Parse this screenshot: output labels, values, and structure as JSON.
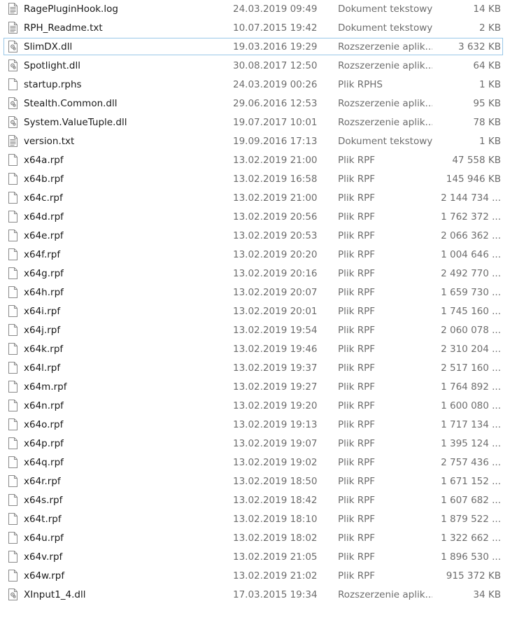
{
  "files": [
    {
      "name": "RagePluginHook.log",
      "date": "24.03.2019 09:49",
      "type": "Dokument tekstowy",
      "size": "14 KB",
      "icon": "text-file-icon"
    },
    {
      "name": "RPH_Readme.txt",
      "date": "10.07.2015 19:42",
      "type": "Dokument tekstowy",
      "size": "2 KB",
      "icon": "text-file-icon"
    },
    {
      "name": "SlimDX.dll",
      "date": "19.03.2016 19:29",
      "type": "Rozszerzenie aplik...",
      "size": "3 632 KB",
      "icon": "dll-file-icon",
      "selected": true
    },
    {
      "name": "Spotlight.dll",
      "date": "30.08.2017 12:50",
      "type": "Rozszerzenie aplik...",
      "size": "64 KB",
      "icon": "dll-file-icon"
    },
    {
      "name": "startup.rphs",
      "date": "24.03.2019 00:26",
      "type": "Plik RPHS",
      "size": "1 KB",
      "icon": "blank-file-icon"
    },
    {
      "name": "Stealth.Common.dll",
      "date": "29.06.2016 12:53",
      "type": "Rozszerzenie aplik...",
      "size": "95 KB",
      "icon": "dll-file-icon"
    },
    {
      "name": "System.ValueTuple.dll",
      "date": "19.07.2017 10:01",
      "type": "Rozszerzenie aplik...",
      "size": "78 KB",
      "icon": "dll-file-icon"
    },
    {
      "name": "version.txt",
      "date": "19.09.2016 17:13",
      "type": "Dokument tekstowy",
      "size": "1 KB",
      "icon": "text-file-icon"
    },
    {
      "name": "x64a.rpf",
      "date": "13.02.2019 21:00",
      "type": "Plik RPF",
      "size": "47 558 KB",
      "icon": "blank-file-icon"
    },
    {
      "name": "x64b.rpf",
      "date": "13.02.2019 16:58",
      "type": "Plik RPF",
      "size": "145 946 KB",
      "icon": "blank-file-icon"
    },
    {
      "name": "x64c.rpf",
      "date": "13.02.2019 21:00",
      "type": "Plik RPF",
      "size": "2 144 734 ...",
      "icon": "blank-file-icon"
    },
    {
      "name": "x64d.rpf",
      "date": "13.02.2019 20:56",
      "type": "Plik RPF",
      "size": "1 762 372 ...",
      "icon": "blank-file-icon"
    },
    {
      "name": "x64e.rpf",
      "date": "13.02.2019 20:53",
      "type": "Plik RPF",
      "size": "2 066 362 ...",
      "icon": "blank-file-icon"
    },
    {
      "name": "x64f.rpf",
      "date": "13.02.2019 20:20",
      "type": "Plik RPF",
      "size": "1 004 646 ...",
      "icon": "blank-file-icon"
    },
    {
      "name": "x64g.rpf",
      "date": "13.02.2019 20:16",
      "type": "Plik RPF",
      "size": "2 492 770 ...",
      "icon": "blank-file-icon"
    },
    {
      "name": "x64h.rpf",
      "date": "13.02.2019 20:07",
      "type": "Plik RPF",
      "size": "1 659 730 ...",
      "icon": "blank-file-icon"
    },
    {
      "name": "x64i.rpf",
      "date": "13.02.2019 20:01",
      "type": "Plik RPF",
      "size": "1 745 160 ...",
      "icon": "blank-file-icon"
    },
    {
      "name": "x64j.rpf",
      "date": "13.02.2019 19:54",
      "type": "Plik RPF",
      "size": "2 060 078 ...",
      "icon": "blank-file-icon"
    },
    {
      "name": "x64k.rpf",
      "date": "13.02.2019 19:46",
      "type": "Plik RPF",
      "size": "2 310 204 ...",
      "icon": "blank-file-icon"
    },
    {
      "name": "x64l.rpf",
      "date": "13.02.2019 19:37",
      "type": "Plik RPF",
      "size": "2 517 160 ...",
      "icon": "blank-file-icon"
    },
    {
      "name": "x64m.rpf",
      "date": "13.02.2019 19:27",
      "type": "Plik RPF",
      "size": "1 764 892 ...",
      "icon": "blank-file-icon"
    },
    {
      "name": "x64n.rpf",
      "date": "13.02.2019 19:20",
      "type": "Plik RPF",
      "size": "1 600 080 ...",
      "icon": "blank-file-icon"
    },
    {
      "name": "x64o.rpf",
      "date": "13.02.2019 19:13",
      "type": "Plik RPF",
      "size": "1 717 134 ...",
      "icon": "blank-file-icon"
    },
    {
      "name": "x64p.rpf",
      "date": "13.02.2019 19:07",
      "type": "Plik RPF",
      "size": "1 395 124 ...",
      "icon": "blank-file-icon"
    },
    {
      "name": "x64q.rpf",
      "date": "13.02.2019 19:02",
      "type": "Plik RPF",
      "size": "2 757 436 ...",
      "icon": "blank-file-icon"
    },
    {
      "name": "x64r.rpf",
      "date": "13.02.2019 18:50",
      "type": "Plik RPF",
      "size": "1 671 152 ...",
      "icon": "blank-file-icon"
    },
    {
      "name": "x64s.rpf",
      "date": "13.02.2019 18:42",
      "type": "Plik RPF",
      "size": "1 607 682 ...",
      "icon": "blank-file-icon"
    },
    {
      "name": "x64t.rpf",
      "date": "13.02.2019 18:10",
      "type": "Plik RPF",
      "size": "1 879 522 ...",
      "icon": "blank-file-icon"
    },
    {
      "name": "x64u.rpf",
      "date": "13.02.2019 18:02",
      "type": "Plik RPF",
      "size": "1 322 662 ...",
      "icon": "blank-file-icon"
    },
    {
      "name": "x64v.rpf",
      "date": "13.02.2019 21:05",
      "type": "Plik RPF",
      "size": "1 896 530 ...",
      "icon": "blank-file-icon"
    },
    {
      "name": "x64w.rpf",
      "date": "13.02.2019 21:02",
      "type": "Plik RPF",
      "size": "915 372 KB",
      "icon": "blank-file-icon"
    },
    {
      "name": "XInput1_4.dll",
      "date": "17.03.2015 19:34",
      "type": "Rozszerzenie aplik...",
      "size": "34 KB",
      "icon": "dll-file-icon"
    }
  ],
  "colors": {
    "selection_border": "#99c7e8",
    "secondary_text": "#6d6d6d",
    "primary_text": "#1a1a1a"
  }
}
